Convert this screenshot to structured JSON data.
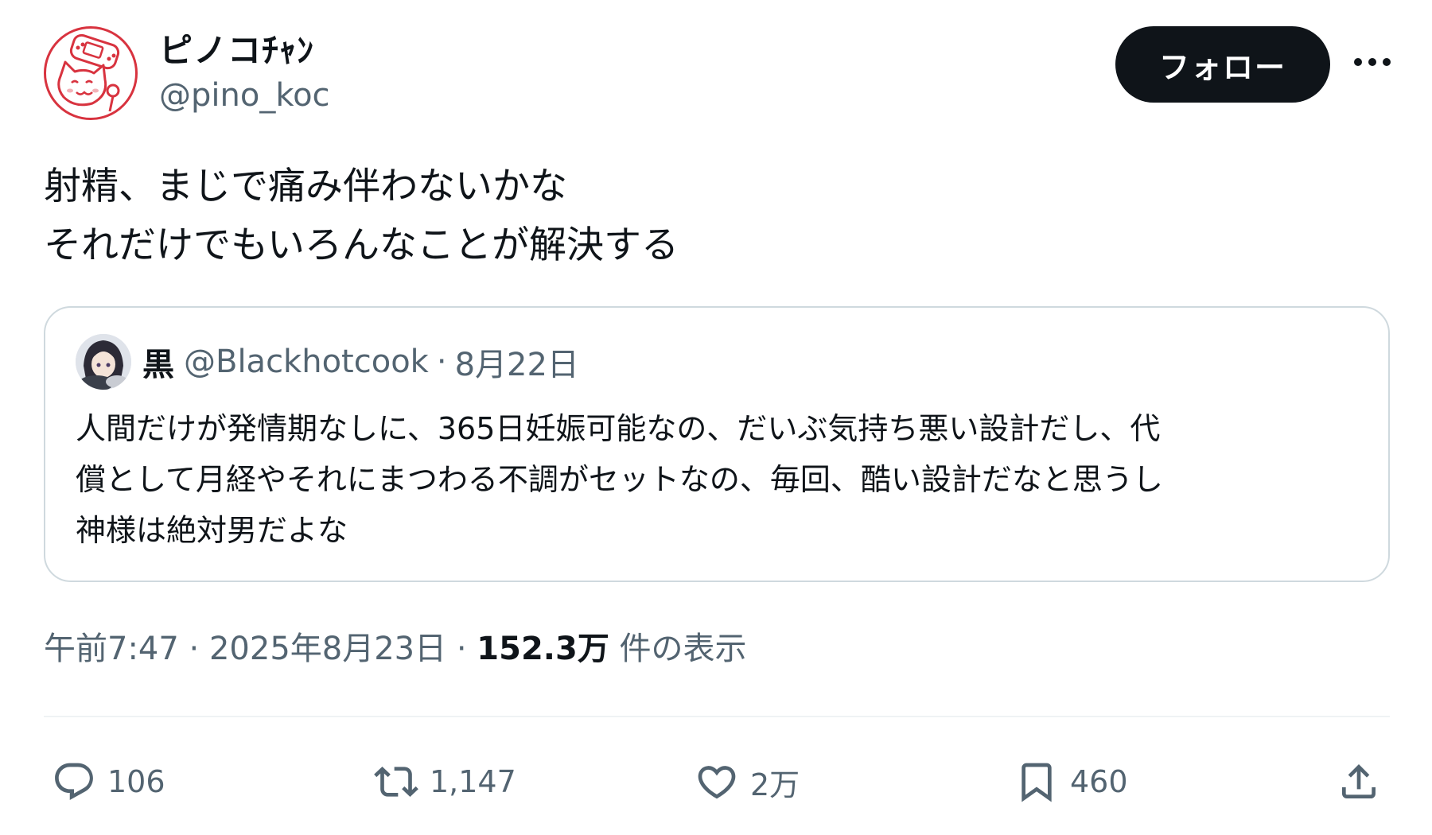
{
  "author": {
    "display_name": "ピノコﾁｬﾝ",
    "handle": "@pino_koc"
  },
  "follow_label": "フォロー",
  "tweet_text": "射精、まじで痛み伴わないかな\nそれだけでもいろんなことが解決する",
  "quote": {
    "display_name": "黒",
    "handle": "@Blackhotcook",
    "separator": "·",
    "date": "8月22日",
    "text": "人間だけが発情期なしに、365日妊娠可能なの、だいぶ気持ち悪い設計だし、代\n償として月経やそれにまつわる不調がセットなの、毎回、酷い設計だなと思うし\n神様は絶対男だよな"
  },
  "meta": {
    "time": "午前7:47",
    "separator": "·",
    "date": "2025年8月23日",
    "views_count": "152.3万",
    "views_label": "件の表示"
  },
  "actions": {
    "reply_count": "106",
    "retweet_count": "1,147",
    "like_count": "2万",
    "bookmark_count": "460"
  },
  "icons": {
    "avatar": "cat-game-controller-icon",
    "more": "more-horizontal-icon",
    "reply": "reply-bubble-icon",
    "retweet": "retweet-icon",
    "like": "heart-icon",
    "bookmark": "bookmark-icon",
    "share": "share-upload-icon"
  },
  "colors": {
    "follow_bg": "#0f1419",
    "secondary_text": "#536471",
    "avatar_accent": "#d8333f",
    "border": "#cfd9de"
  }
}
